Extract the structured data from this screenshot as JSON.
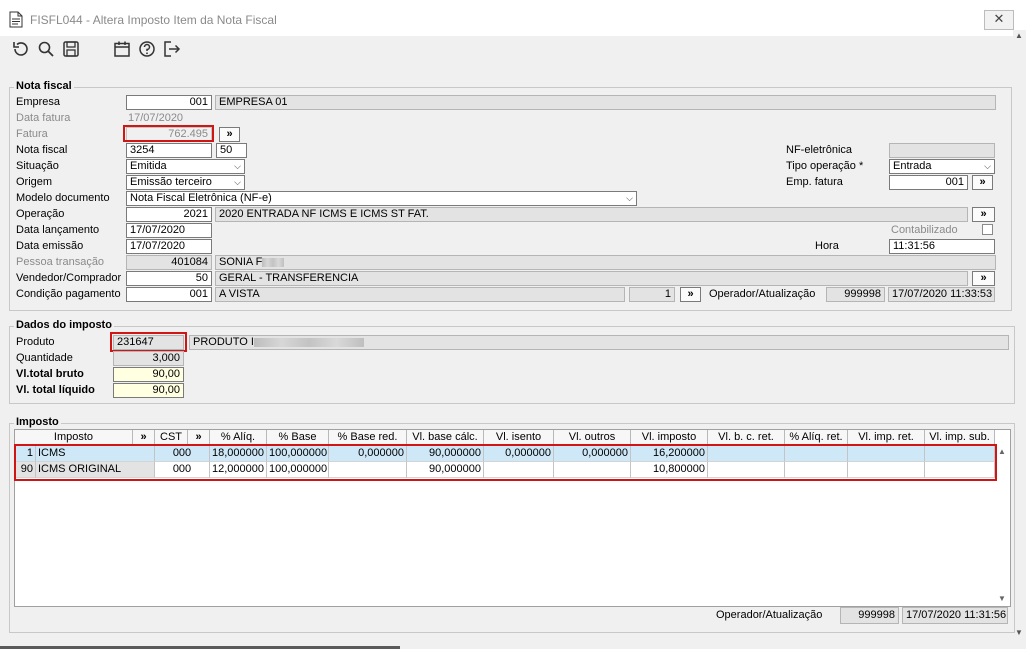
{
  "window": {
    "title": "FISFL044 - Altera Imposto Item da Nota Fiscal",
    "close_label": "✕"
  },
  "toolbar": {
    "icons": [
      "undo-icon",
      "search-icon",
      "save-icon",
      "calendar-icon",
      "help-icon",
      "exit-icon"
    ]
  },
  "nota_fiscal": {
    "group_title": "Nota fiscal",
    "empresa_label": "Empresa",
    "empresa_code": "001",
    "empresa_name": "EMPRESA 01",
    "data_fatura_label": "Data fatura",
    "data_fatura_value": "17/07/2020",
    "fatura_label": "Fatura",
    "fatura_value": "762.495",
    "fatura_btn": "»",
    "nota_fiscal_label": "Nota fiscal",
    "nota_fiscal_value": "3254",
    "serie_value": "50",
    "nfe_label": "NF-eletrônica",
    "situacao_label": "Situação",
    "situacao_value": "Emitida",
    "tipo_operacao_label": "Tipo operação *",
    "tipo_operacao_value": "Entrada",
    "origem_label": "Origem",
    "origem_value": "Emissão terceiro",
    "emp_fatura_label": "Emp. fatura",
    "emp_fatura_value": "001",
    "emp_fatura_btn": "»",
    "modelo_label": "Modelo documento",
    "modelo_value": "Nota Fiscal Eletrônica (NF-e)",
    "operacao_label": "Operação",
    "operacao_code": "2021",
    "operacao_desc": "2020 ENTRADA NF ICMS E ICMS ST FAT.",
    "operacao_btn": "»",
    "data_lancamento_label": "Data lançamento",
    "data_lancamento_value": "17/07/2020",
    "contabilizado_label": "Contabilizado",
    "data_emissao_label": "Data emissão",
    "data_emissao_value": "17/07/2020",
    "hora_label": "Hora",
    "hora_value": "11:31:56",
    "pessoa_label": "Pessoa transação",
    "pessoa_code": "401084",
    "pessoa_name": "SONIA F",
    "vendedor_label": "Vendedor/Comprador",
    "vendedor_code": "50",
    "vendedor_name": "GERAL - TRANSFERENCIA",
    "vendedor_btn": "»",
    "condicao_label": "Condição pagamento",
    "condicao_code": "001",
    "condicao_desc": "A VISTA",
    "parcelas_value": "1",
    "parcelas_btn": "»",
    "operador_label": "Operador/Atualização",
    "operador_code": "999998",
    "operador_datetime": "17/07/2020 11:33:53"
  },
  "dados_imposto": {
    "group_title": "Dados do imposto",
    "produto_label": "Produto",
    "produto_code": "231647",
    "produto_desc": "PRODUTO I",
    "quantidade_label": "Quantidade",
    "quantidade_value": "3,000",
    "vl_bruto_label": "Vl.total bruto",
    "vl_bruto_value": "90,00",
    "vl_liquido_label": "Vl. total líquido",
    "vl_liquido_value": "90,00"
  },
  "imposto": {
    "group_title": "Imposto",
    "columns": [
      "Imposto",
      "»",
      "CST",
      "»",
      "% Alíq.",
      "% Base",
      "% Base red.",
      "Vl. base cálc.",
      "Vl. isento",
      "Vl. outros",
      "Vl. imposto",
      "Vl. b. c. ret.",
      "% Alíq. ret.",
      "Vl. imp. ret.",
      "Vl. imp. sub."
    ],
    "rows": [
      {
        "code": "1",
        "name": "ICMS",
        "cst": "000",
        "aliq": "18,000000",
        "base": "100,000000",
        "base_red": "0,000000",
        "base_calc": "90,000000",
        "isento": "0,000000",
        "outros": "0,000000",
        "imposto": "16,200000",
        "bc_ret": "",
        "aliq_ret": "",
        "imp_ret": "",
        "imp_sub": ""
      },
      {
        "code": "90",
        "name": "ICMS ORIGINAL",
        "cst": "000",
        "aliq": "12,000000",
        "base": "100,000000",
        "base_red": "",
        "base_calc": "90,000000",
        "isento": "",
        "outros": "",
        "imposto": "10,800000",
        "bc_ret": "",
        "aliq_ret": "",
        "imp_ret": "",
        "imp_sub": ""
      }
    ],
    "operador_label": "Operador/Atualização",
    "operador_code": "999998",
    "operador_datetime": "17/07/2020 11:31:56"
  }
}
